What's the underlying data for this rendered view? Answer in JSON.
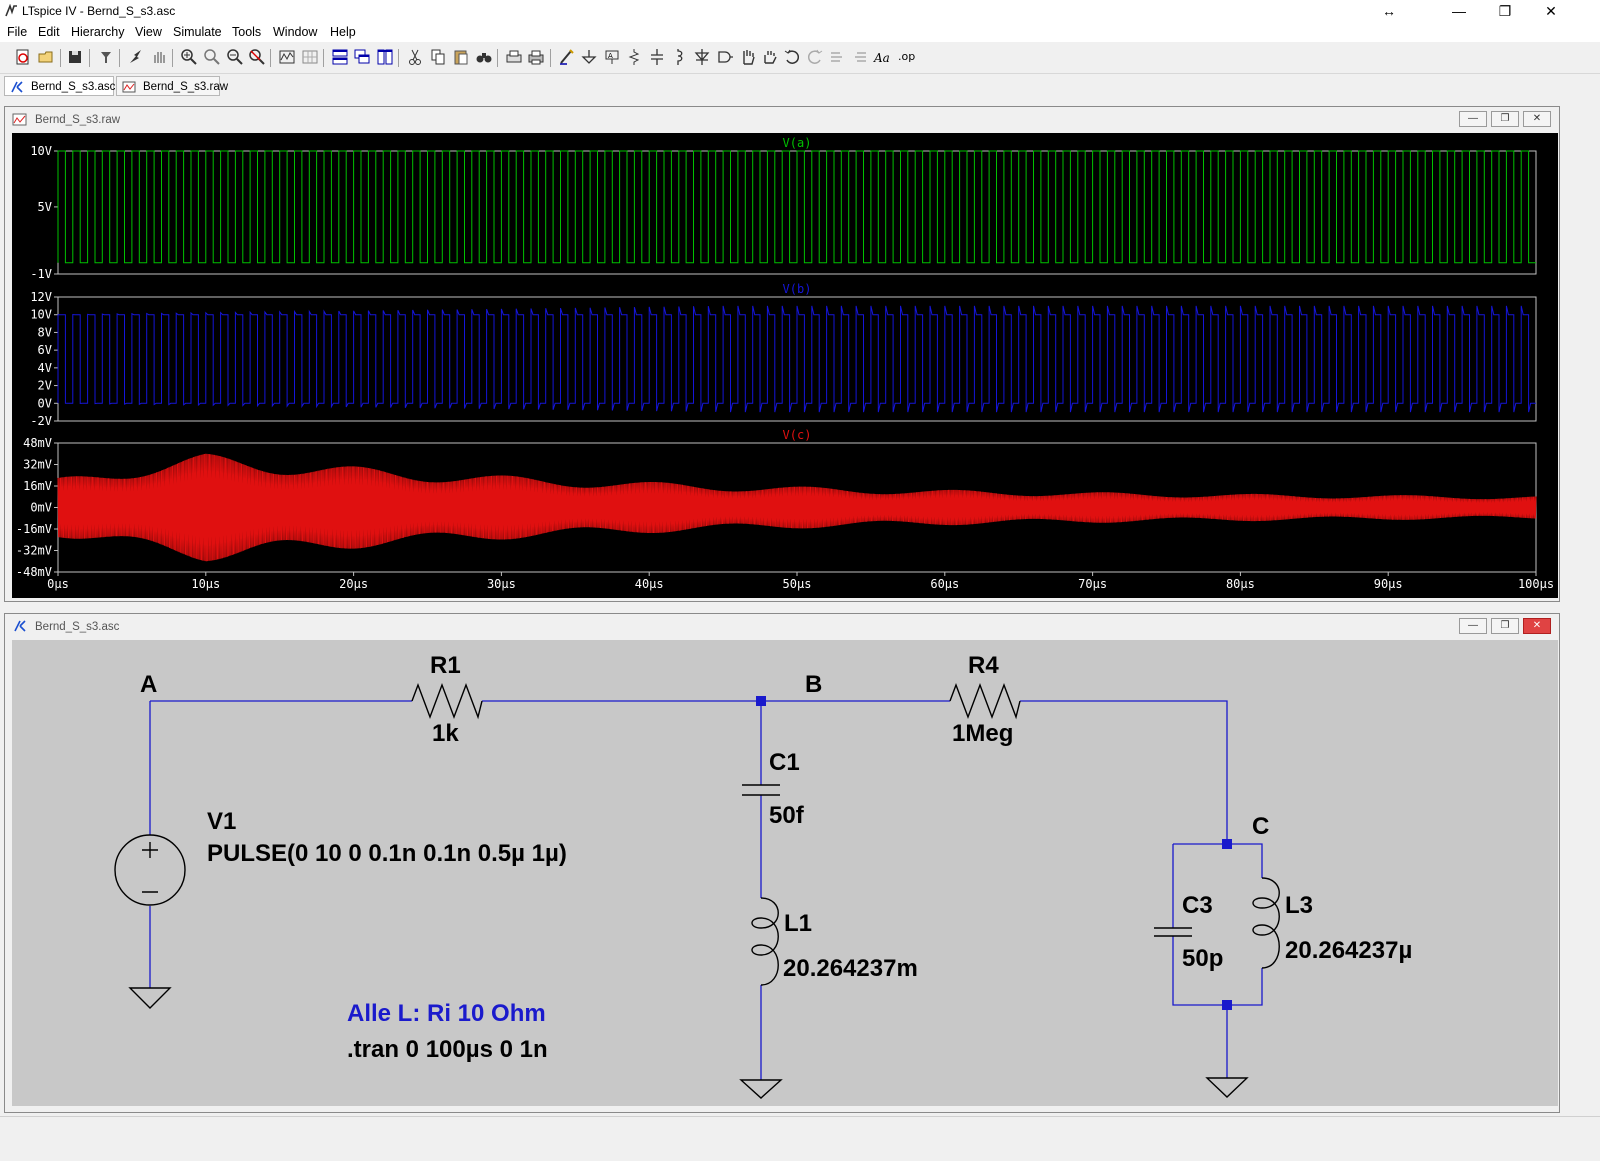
{
  "app": {
    "title": "LTspice IV - Bernd_S_s3.asc",
    "resize_glyph": "↔",
    "min_glyph": "—",
    "restore_glyph": "❐",
    "close_glyph": "✕"
  },
  "menu": [
    "File",
    "Edit",
    "Hierarchy",
    "View",
    "Simulate",
    "Tools",
    "Window",
    "Help"
  ],
  "toolbar": {
    "icons": [
      "new-schematic-icon",
      "open-icon",
      "save-icon",
      "control-panel-icon",
      "run-icon",
      "halt-icon",
      "zoom-in-icon",
      "zoom-fit-icon",
      "zoom-out-icon",
      "zoom-cancel-icon",
      "autorange-icon",
      "grid-icon",
      "tile-horizontal-icon",
      "cascade-icon",
      "tile-vertical-icon",
      "cut-icon",
      "copy-icon",
      "paste-icon",
      "find-icon",
      "print-preview-icon",
      "print-icon",
      "wire-icon",
      "ground-icon",
      "label-icon",
      "resistor-icon",
      "capacitor-icon",
      "inductor-icon",
      "diode-icon",
      "component-icon",
      "move-icon",
      "drag-icon",
      "undo-icon",
      "redo-icon",
      "rotate-icon",
      "mirror-icon",
      "text-icon",
      "spice-directive-icon"
    ],
    "text_label": "Aa",
    "directive_label": ".op"
  },
  "tabs": [
    {
      "label": "Bernd_S_s3.asc",
      "kind": "schematic"
    },
    {
      "label": "Bernd_S_s3.raw",
      "kind": "waveform"
    }
  ],
  "waveform_window": {
    "title": "Bernd_S_s3.raw",
    "minimize": "—",
    "restore": "❐",
    "close": "✕"
  },
  "schematic_window": {
    "title": "Bernd_S_s3.asc",
    "minimize": "—",
    "restore": "❐",
    "close": "✕"
  },
  "chart_data": [
    {
      "type": "line",
      "title": "V(a)",
      "color": "#00c000",
      "xlabel": "",
      "ylabel": "",
      "x_ticks": [
        "0µs",
        "10µs",
        "20µs",
        "30µs",
        "40µs",
        "50µs",
        "60µs",
        "70µs",
        "80µs",
        "90µs",
        "100µs"
      ],
      "y_ticks": [
        "10V",
        "5V",
        "-1V"
      ],
      "ylim": [
        -1,
        10
      ],
      "xlim": [
        0,
        100
      ],
      "series": [
        {
          "name": "V(a)",
          "shape": "pulse",
          "period_us": 1,
          "low": 0,
          "high": 10
        }
      ]
    },
    {
      "type": "line",
      "title": "V(b)",
      "color": "#1515d8",
      "xlabel": "",
      "ylabel": "",
      "y_ticks": [
        "12V",
        "10V",
        "8V",
        "6V",
        "4V",
        "2V",
        "0V",
        "-2V"
      ],
      "ylim": [
        -2,
        12
      ],
      "xlim": [
        0,
        100
      ],
      "series": [
        {
          "name": "V(b)",
          "shape": "pulse",
          "period_us": 1,
          "low": 0,
          "high": 10,
          "overshoot_max": 11,
          "undershoot_min": -1
        }
      ]
    },
    {
      "type": "line",
      "title": "V(c)",
      "color": "#e01010",
      "xlabel": "",
      "ylabel": "",
      "x_ticks": [
        "0µs",
        "10µs",
        "20µs",
        "30µs",
        "40µs",
        "50µs",
        "60µs",
        "70µs",
        "80µs",
        "90µs",
        "100µs"
      ],
      "y_ticks": [
        "48mV",
        "32mV",
        "16mV",
        "0mV",
        "-16mV",
        "-32mV",
        "-48mV"
      ],
      "ylim": [
        -48,
        48
      ],
      "xlim": [
        0,
        100
      ],
      "series": [
        {
          "name": "V(c)",
          "shape": "oscillation",
          "amplitude_peak_mV": 40,
          "amplitude_end_mV": 7
        }
      ]
    }
  ],
  "schematic": {
    "nodes": {
      "a": "A",
      "b": "B",
      "c": "C"
    },
    "r1": {
      "name": "R1",
      "value": "1k"
    },
    "r4": {
      "name": "R4",
      "value": "1Meg"
    },
    "c1": {
      "name": "C1",
      "value": "50f"
    },
    "l1": {
      "name": "L1",
      "value": "20.264237m"
    },
    "c3": {
      "name": "C3",
      "value": "50p"
    },
    "l3": {
      "name": "L3",
      "value": "20.264237µ"
    },
    "v1": {
      "name": "V1",
      "value": "PULSE(0 10 0 0.1n 0.1n 0.5µ 1µ)"
    },
    "comment": "Alle L: Ri 10 Ohm",
    "directive": ".tran 0 100µs 0 1n"
  }
}
